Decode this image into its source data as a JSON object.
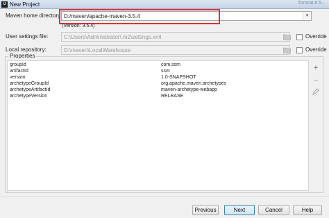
{
  "window": {
    "title": "New Project",
    "right_text": "Tomcat 8.5..."
  },
  "maven_home": {
    "label": "Maven home directory:",
    "value": "D:/maven/apache-maven-3.5.4",
    "version": "(Version: 3.5.4)"
  },
  "user_settings": {
    "label": "User settings file:",
    "value": "C:\\Users\\Administrator\\.m2\\settings.xml",
    "override_label": "Override"
  },
  "local_repo": {
    "label": "Local repository:",
    "value": "D:\\maven\\LocalWarehouse",
    "override_label": "Override"
  },
  "properties": {
    "legend": "Properties",
    "rows": [
      {
        "key": "groupId",
        "value": "com.ssm"
      },
      {
        "key": "artifactId",
        "value": "ssm"
      },
      {
        "key": "version",
        "value": "1.0-SNAPSHOT"
      },
      {
        "key": "archetypeGroupId",
        "value": "org.apache.maven.archetypes"
      },
      {
        "key": "archetypeArtifactId",
        "value": "maven-archetype-webapp"
      },
      {
        "key": "archetypeVersion",
        "value": "RELEASE"
      }
    ]
  },
  "buttons": {
    "previous": "Previous",
    "next": "Next",
    "cancel": "Cancel",
    "help": "Help"
  },
  "colors": {
    "highlight": "#e0303a",
    "default_button": "#3c7fb1"
  }
}
